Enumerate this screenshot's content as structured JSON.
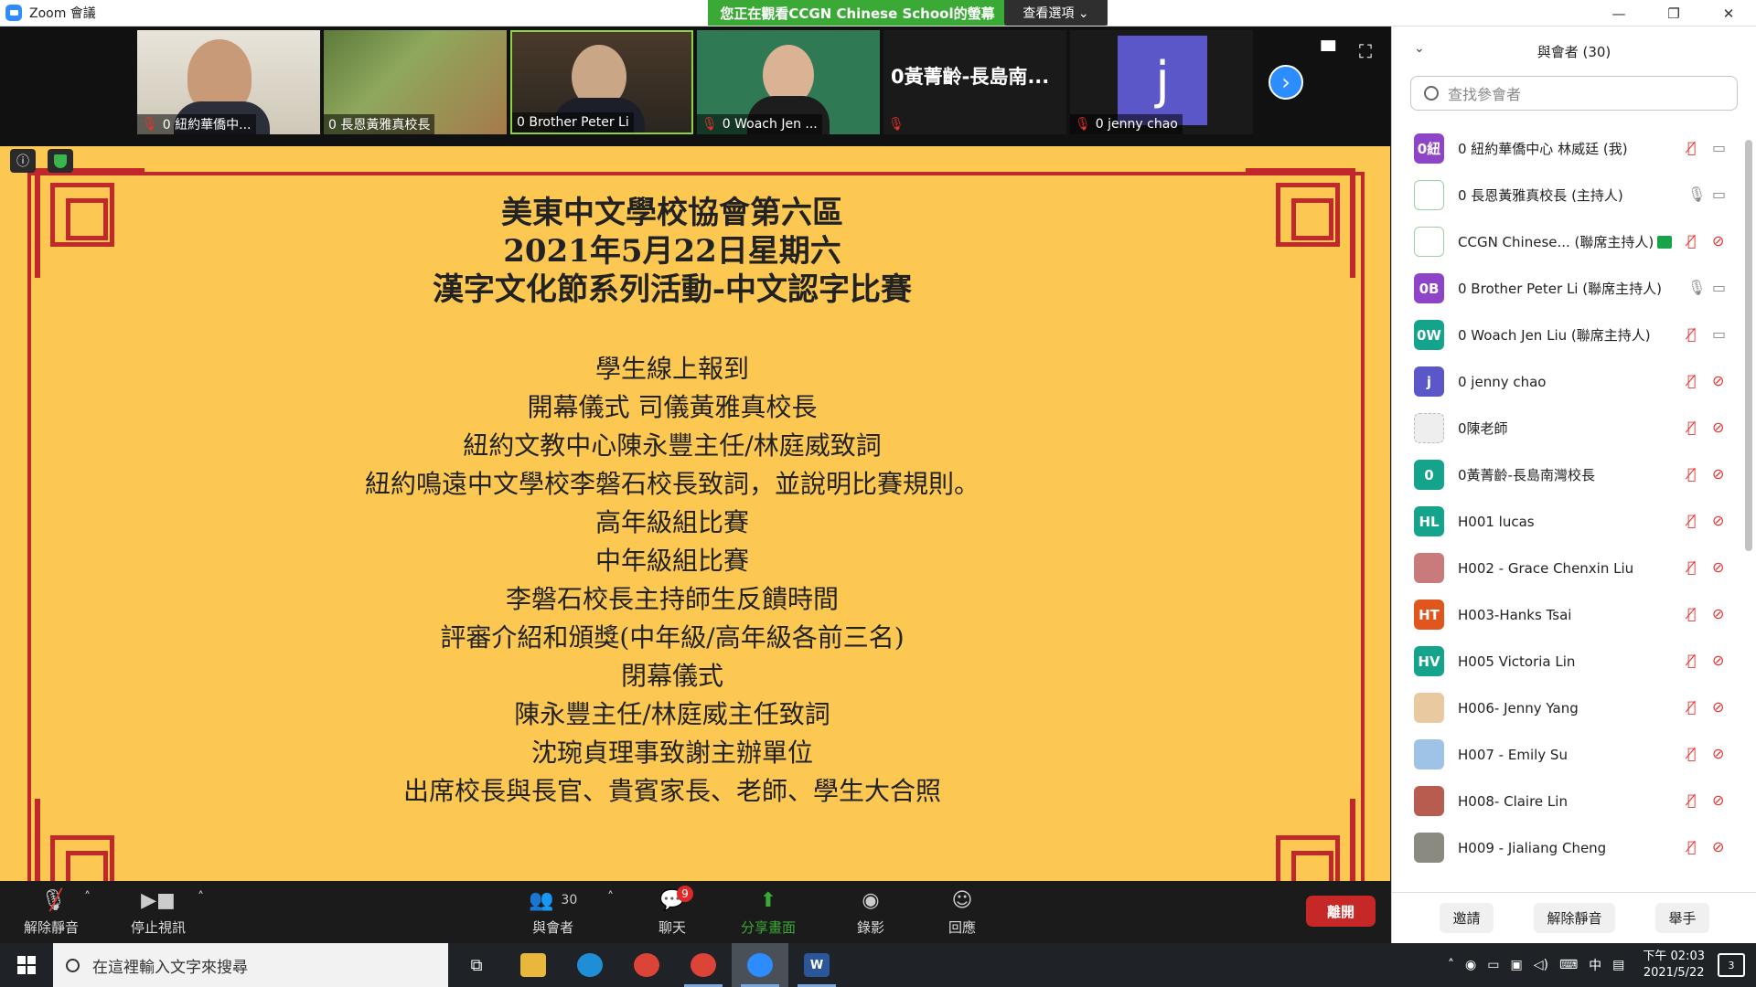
{
  "window": {
    "title": "Zoom 會議",
    "minimize": "—",
    "maximize": "❐",
    "close": "✕"
  },
  "share_banner": {
    "text": "您正在觀看CCGN Chinese School的螢幕",
    "view_options": "查看選項 ⌄"
  },
  "video_tiles": [
    {
      "name": "0 紐約華僑中...",
      "muted": true
    },
    {
      "name": "0 長恩黃雅真校長",
      "muted": false
    },
    {
      "name": "0 Brother Peter Li",
      "muted": false
    },
    {
      "name": "0 Woach Jen ...",
      "muted": true
    },
    {
      "name": "0黃菁齡-長島南...",
      "muted": true
    },
    {
      "name": "0 jenny chao",
      "muted": true,
      "avatar": "j"
    }
  ],
  "slide": {
    "title_lines": [
      "美東中文學校協會第六區",
      "2021年5月22日星期六",
      "漢字文化節系列活動-中文認字比賽"
    ],
    "items": [
      "學生線上報到",
      "開幕儀式  司儀黃雅真校長",
      "紐約文教中心陳永豐主任/林庭威致詞",
      "紐約鳴遠中文學校李磐石校長致詞，並說明比賽規則。",
      "高年級組比賽",
      "中年級組比賽",
      "李磐石校長主持師生反饋時間",
      "評審介紹和頒獎(中年級/高年級各前三名)",
      "閉幕儀式",
      "陳永豐主任/林庭威主任致詞",
      "沈琬貞理事致謝主辦單位",
      "出席校長與長官、貴賓家長、老師、學生大合照"
    ]
  },
  "toolbar": {
    "unmute": "解除靜音",
    "stop_video": "停止視訊",
    "participants": "與會者",
    "participants_count": "30",
    "chat": "聊天",
    "chat_badge": "9",
    "share": "分享畫面",
    "record": "錄影",
    "reactions": "回應",
    "leave": "離開"
  },
  "panel": {
    "title": "與會者 (30)",
    "search_placeholder": "查找參會者",
    "participants": [
      {
        "initials": "0紐",
        "color": "#8e44c6",
        "name": "0 紐約華僑中心 林威廷 (我)",
        "mic": "muted",
        "cam": "on"
      },
      {
        "initials": "",
        "color": "#ffffff",
        "name": "0 長恩黃雅真校長 (主持人)",
        "mic": "on",
        "cam": "on",
        "logo": true
      },
      {
        "initials": "",
        "color": "#ffffff",
        "name": "CCGN Chinese... (聯席主持人)",
        "mic": "muted",
        "cam": "off",
        "logo": true,
        "sharing": true
      },
      {
        "initials": "0B",
        "color": "#8e44c6",
        "name": "0 Brother Peter Li (聯席主持人)",
        "mic": "on",
        "cam": "on"
      },
      {
        "initials": "0W",
        "color": "#14a38b",
        "name": "0 Woach Jen Liu (聯席主持人)",
        "mic": "muted",
        "cam": "on"
      },
      {
        "initials": "j",
        "color": "#5b57c9",
        "name": "0 jenny chao",
        "mic": "muted",
        "cam": "off"
      },
      {
        "initials": "",
        "color": "#eeeeee",
        "name": "0陳老師",
        "mic": "muted",
        "cam": "off"
      },
      {
        "initials": "0",
        "color": "#14a38b",
        "name": "0黃菁齡-長島南灣校長",
        "mic": "muted",
        "cam": "off"
      },
      {
        "initials": "HL",
        "color": "#14a38b",
        "name": "H001 lucas",
        "mic": "muted",
        "cam": "off"
      },
      {
        "initials": "",
        "color": "#c97a7a",
        "name": "H002 - Grace Chenxin Liu",
        "mic": "muted",
        "cam": "off"
      },
      {
        "initials": "HT",
        "color": "#e0561d",
        "name": "H003-Hanks Tsai",
        "mic": "muted",
        "cam": "off"
      },
      {
        "initials": "HV",
        "color": "#14a38b",
        "name": "H005 Victoria Lin",
        "mic": "muted",
        "cam": "off"
      },
      {
        "initials": "",
        "color": "#e8c9a0",
        "name": "H006- Jenny Yang",
        "mic": "muted",
        "cam": "off"
      },
      {
        "initials": "",
        "color": "#9fc3e6",
        "name": "H007 - Emily Su",
        "mic": "muted",
        "cam": "off"
      },
      {
        "initials": "",
        "color": "#b85c4f",
        "name": "H008- Claire Lin",
        "mic": "muted",
        "cam": "off"
      },
      {
        "initials": "",
        "color": "#8a8a80",
        "name": "H009 - Jialiang Cheng",
        "mic": "muted",
        "cam": "off"
      }
    ],
    "footer": {
      "invite": "邀請",
      "unmute_all": "解除靜音",
      "raise_hand": "舉手"
    }
  },
  "taskbar": {
    "search_placeholder": "在這裡輸入文字來搜尋",
    "time": "下午 02:03",
    "date": "2021/5/22",
    "ime": "中",
    "notifications": "3"
  }
}
